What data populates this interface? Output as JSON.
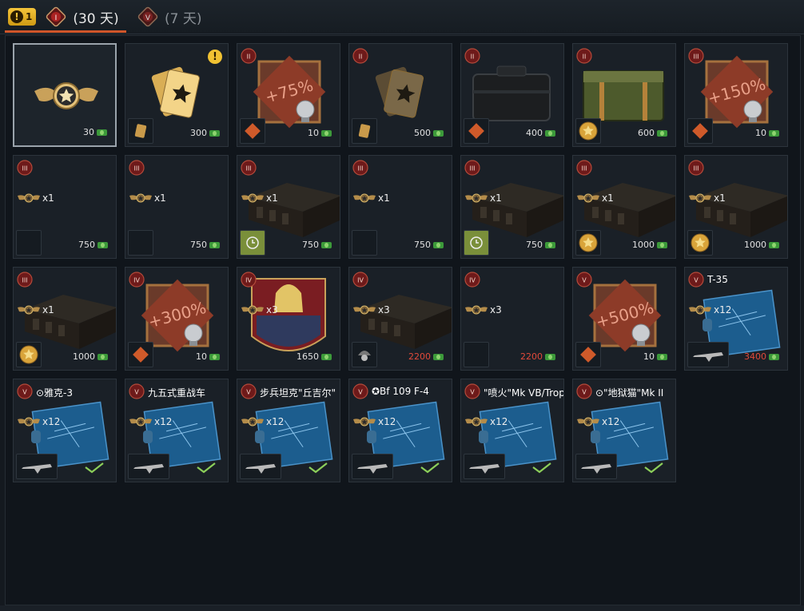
{
  "tabs": [
    {
      "badge_count": "1",
      "label": "(30 天)",
      "rank": "I"
    },
    {
      "label": "(7 天)",
      "rank": "V"
    }
  ],
  "rows": [
    [
      {
        "kind": "emblem",
        "price": "30"
      },
      {
        "kind": "cards-gold",
        "price": "300",
        "warn": "!"
      },
      {
        "kind": "booster",
        "rank": "II",
        "percent": "+75%",
        "price": "10"
      },
      {
        "kind": "cards-dark",
        "rank": "II",
        "price": "500"
      },
      {
        "kind": "case-black",
        "rank": "II",
        "price": "400"
      },
      {
        "kind": "case-camo",
        "rank": "II",
        "price": "600"
      },
      {
        "kind": "booster",
        "rank": "III",
        "percent": "+150%",
        "price": "10"
      }
    ],
    [
      {
        "kind": "empty",
        "rank": "III",
        "qty": "x1",
        "price": "750"
      },
      {
        "kind": "empty",
        "rank": "III",
        "qty": "x1",
        "price": "750"
      },
      {
        "kind": "crate",
        "rank": "III",
        "qty": "x1",
        "price": "750"
      },
      {
        "kind": "empty",
        "rank": "III",
        "qty": "x1",
        "price": "750"
      },
      {
        "kind": "crate",
        "rank": "III",
        "qty": "x1",
        "price": "750"
      },
      {
        "kind": "crate",
        "rank": "III",
        "qty": "x1",
        "price": "1000"
      },
      {
        "kind": "crate",
        "rank": "III",
        "qty": "x1",
        "price": "1000"
      }
    ],
    [
      {
        "kind": "crate",
        "rank": "III",
        "qty": "x1",
        "price": "1000"
      },
      {
        "kind": "booster",
        "rank": "IV",
        "percent": "+300%",
        "price": "10"
      },
      {
        "kind": "portrait",
        "rank": "IV",
        "qty": "x3",
        "price": "1650"
      },
      {
        "kind": "crate",
        "rank": "IV",
        "qty": "x3",
        "price": "2200",
        "red": true
      },
      {
        "kind": "empty",
        "rank": "IV",
        "qty": "x3",
        "price": "2200",
        "red": true
      },
      {
        "kind": "booster",
        "rank": "V",
        "percent": "+500%",
        "price": "10"
      },
      {
        "kind": "blueprint",
        "rank": "V",
        "label": "T-35",
        "qty": "x12",
        "price": "3400",
        "red": true
      }
    ],
    [
      {
        "kind": "blueprint",
        "rank": "V",
        "label": "⊙雅克-3",
        "qty": "x12",
        "owned": true
      },
      {
        "kind": "blueprint",
        "rank": "V",
        "label": "九五式重战车",
        "qty": "x12",
        "owned": true
      },
      {
        "kind": "blueprint",
        "rank": "V",
        "label": "步兵坦克\"丘吉尔\"",
        "qty": "x12",
        "owned": true
      },
      {
        "kind": "blueprint",
        "rank": "V",
        "label": "✪Bf 109 F-4",
        "qty": "x12",
        "owned": true
      },
      {
        "kind": "blueprint",
        "rank": "V",
        "label": "\"喷火\"Mk VB/Trop",
        "qty": "x12",
        "owned": true
      },
      {
        "kind": "blueprint",
        "rank": "V",
        "label": "⊙\"地狱猫\"Mk II",
        "qty": "x12",
        "owned": true
      }
    ]
  ],
  "colors": {
    "accent": "#d0562a",
    "gold": "#e5b84a",
    "rank_red": "#8f1f1f",
    "price_red": "#e24a3a",
    "check": "#8ccf5a"
  }
}
